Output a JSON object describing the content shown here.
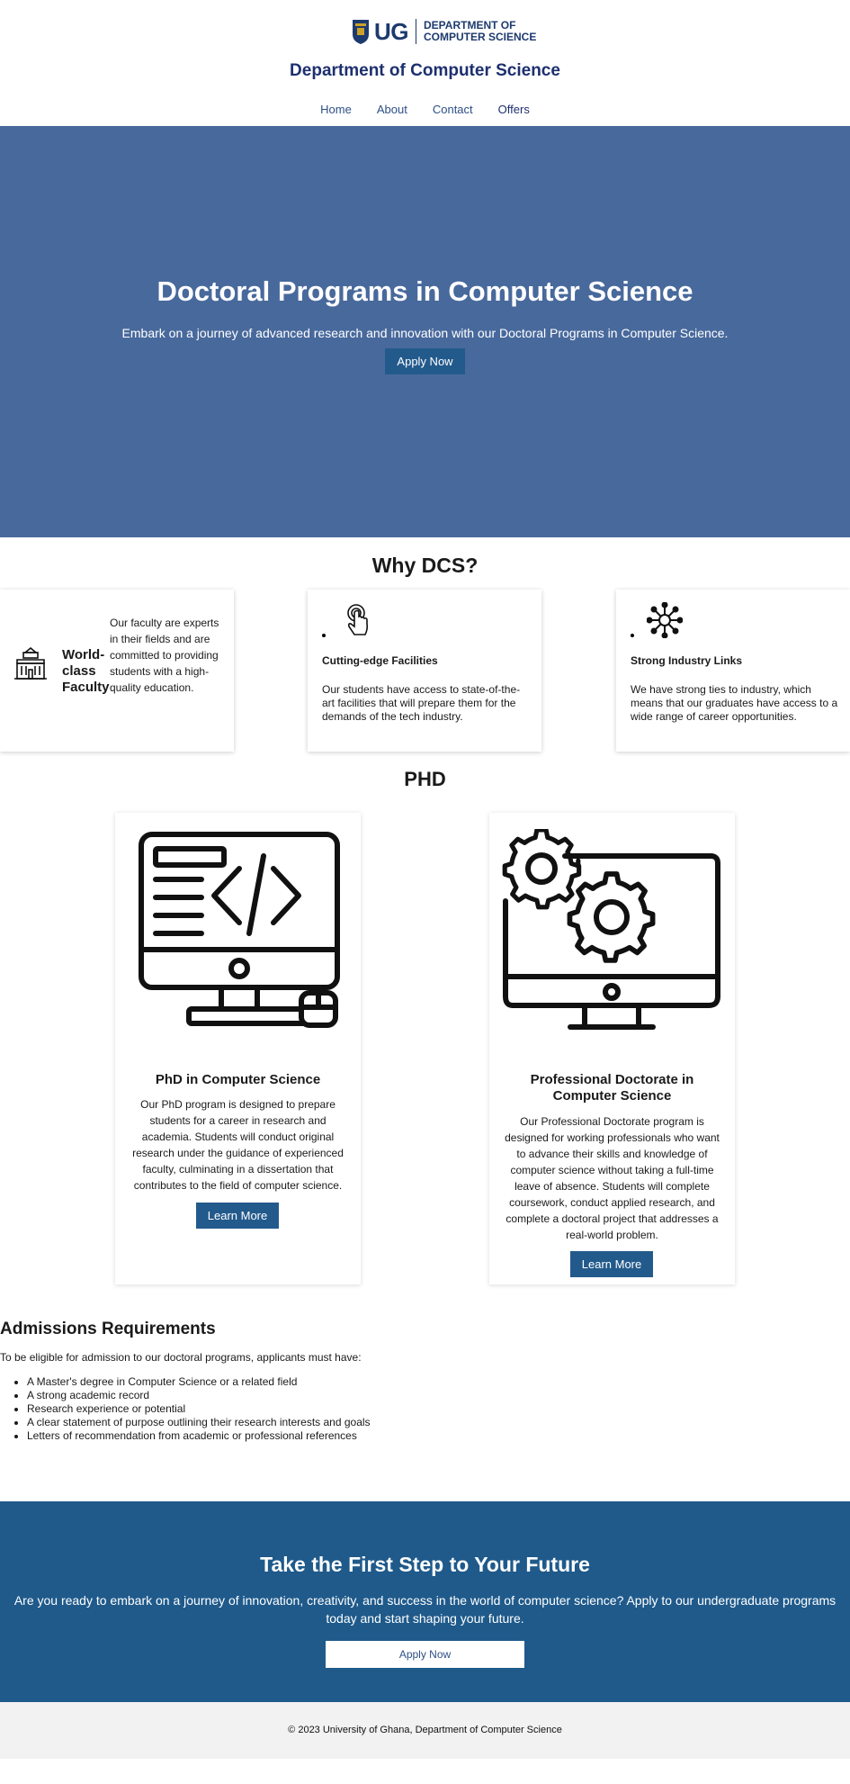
{
  "header": {
    "logo_text": "UG",
    "logo_dept_line1": "DEPARTMENT OF",
    "logo_dept_line2": "COMPUTER SCIENCE",
    "title": "Department of Computer Science",
    "nav": [
      "Home",
      "About",
      "Contact",
      "Offers"
    ]
  },
  "hero": {
    "title": "Doctoral Programs in Computer Science",
    "subtitle": "Embark on a journey of advanced research and innovation with our Doctoral Programs in Computer Science.",
    "button": "Apply Now"
  },
  "why": {
    "title": "Why DCS?",
    "cards": [
      {
        "icon": "university-building-icon",
        "heading": "World-class Faculty",
        "text": "Our faculty are experts in their fields and are committed to providing students with a high-quality education."
      },
      {
        "icon": "touch-hand-icon",
        "heading": "Cutting-edge Facilities",
        "text": "Our students have access to state-of-the-art facilities that will prepare them for the demands of the tech industry."
      },
      {
        "icon": "network-hub-icon",
        "heading": "Strong Industry Links",
        "text": "We have strong ties to industry, which means that our graduates have access to a wide range of career opportunities."
      }
    ]
  },
  "phd": {
    "title": "PHD",
    "cards": [
      {
        "icon": "computer-code-icon",
        "heading": "PhD in Computer Science",
        "text": "Our PhD program is designed to prepare students for a career in research and academia. Students will conduct original research under the guidance of experienced faculty, culminating in a dissertation that contributes to the field of computer science.",
        "button": "Learn More"
      },
      {
        "icon": "computer-gears-icon",
        "heading": "Professional Doctorate in Computer Science",
        "text": "Our Professional Doctorate program is designed for working professionals who want to advance their skills and knowledge of computer science without taking a full-time leave of absence. Students will complete coursework, conduct applied research, and complete a doctoral project that addresses a real-world problem.",
        "button": "Learn More"
      }
    ]
  },
  "admissions": {
    "title": "Admissions Requirements",
    "intro": "To be eligible for admission to our doctoral programs, applicants must have:",
    "items": [
      "A Master's degree in Computer Science or a related field",
      "A strong academic record",
      "Research experience or potential",
      "A clear statement of purpose outlining their research interests and goals",
      "Letters of recommendation from academic or professional references"
    ]
  },
  "cta": {
    "title": "Take the First Step to Your Future",
    "text": "Are you ready to embark on a journey of innovation, creativity, and success in the world of computer science? Apply to our undergraduate programs today and start shaping your future.",
    "button": "Apply Now"
  },
  "footer": {
    "text": "© 2023 University of Ghana, Department of Computer Science"
  },
  "colors": {
    "hero_bg": "#48699c",
    "accent_button": "#235a8c",
    "cta_bg": "#1f5a8b",
    "brand_navy": "#1d2f6e",
    "footer_bg": "#f2f2f2"
  }
}
